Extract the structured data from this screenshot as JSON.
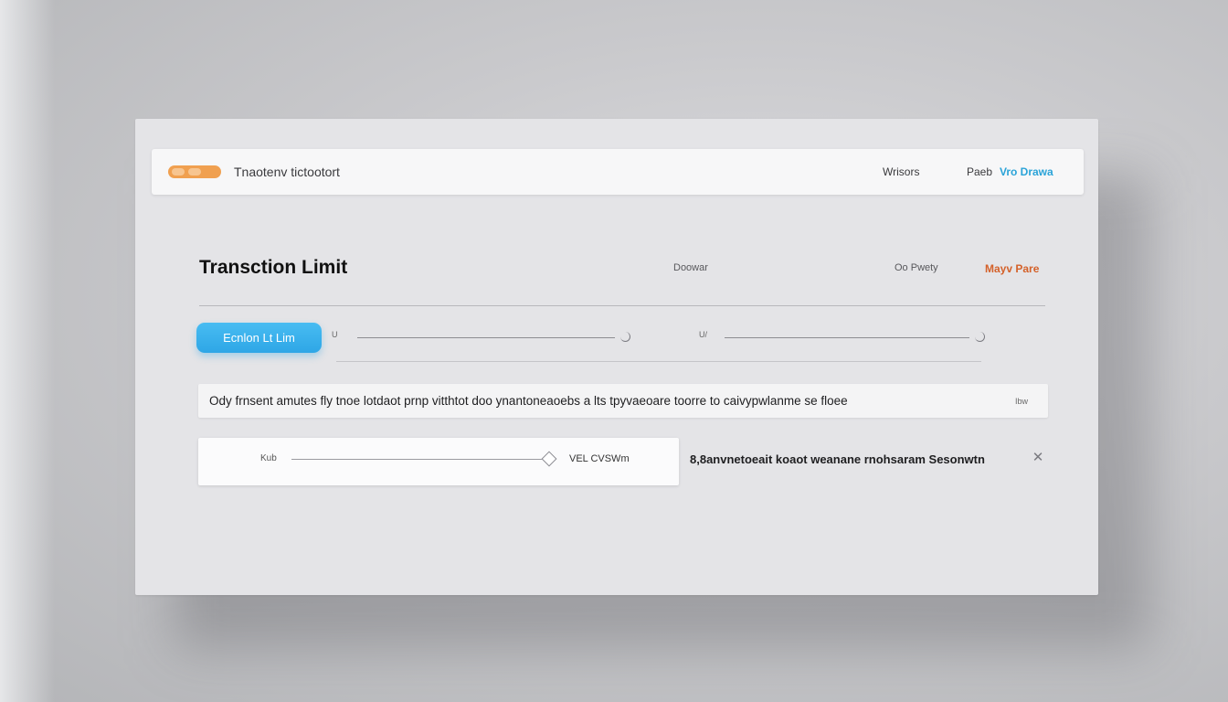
{
  "header": {
    "title": "Tnaotenv tictootort",
    "nav": {
      "item1": "Wrisors",
      "item2": "Paeb",
      "item3": "Vro Drawa"
    },
    "logo_icon": "orange-pill-logo"
  },
  "section": {
    "title": "Transction Limit",
    "col_labels": [
      "Doowar",
      "Oo Pwety",
      "Mayv Pare"
    ]
  },
  "actions": {
    "primary_label": "Ecnlon Lt Lim"
  },
  "sliders": {
    "left_label": "U",
    "right_label": "U/"
  },
  "info": {
    "text": "Ody frnsent amutes fly tnoe lotdaot prnp vitthtot doo ynantoneaoebs a lts tpyvaeoare toorre to caivypwlanme se floee",
    "tag": "Ibw"
  },
  "slider_box": {
    "label": "Kub",
    "value_text": "VEL CVSWm",
    "level": 0.95
  },
  "description": "8,8anvnetoeait koaot weanane rnohsaram Sesonwtn",
  "colors": {
    "accent_blue": "#2ea6e6",
    "accent_orange": "#d4612a",
    "logo_orange": "#f0a050"
  }
}
